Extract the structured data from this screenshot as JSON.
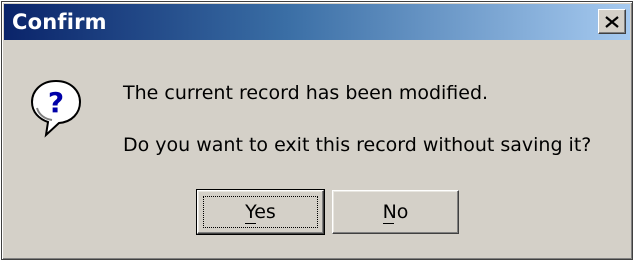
{
  "window": {
    "title": "Confirm",
    "close_icon": "close-icon"
  },
  "message": {
    "icon": "question-icon",
    "line1": "The current record has been modified.",
    "line2": "Do you want to exit this record without saving it?"
  },
  "buttons": {
    "yes": "Yes",
    "no": "No",
    "default": "yes"
  },
  "colors": {
    "title_bar_start": "#0a246a",
    "title_bar_end": "#a6caf0",
    "face": "#d4d0c8",
    "icon_blue": "#0000a8"
  }
}
